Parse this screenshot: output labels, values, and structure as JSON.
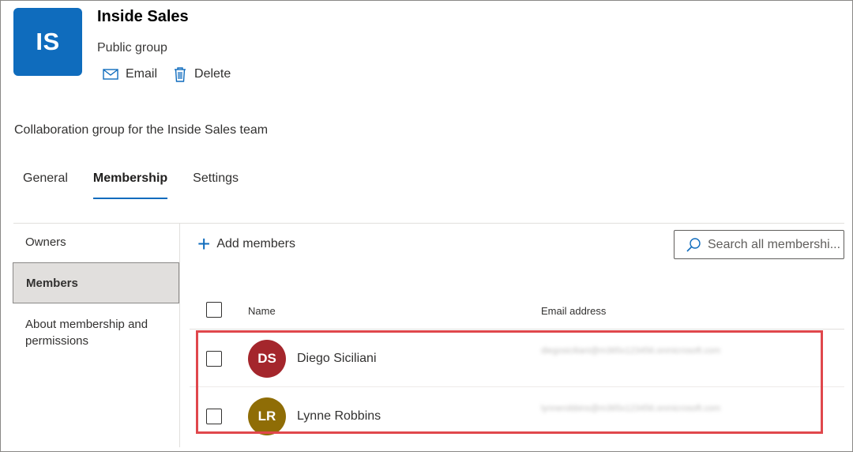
{
  "group": {
    "initials": "IS",
    "name": "Inside Sales",
    "type": "Public group",
    "description": "Collaboration group for the Inside Sales team",
    "tile_color": "#0f6cbd"
  },
  "actions": {
    "email_label": "Email",
    "email_icon": "mail-icon",
    "delete_label": "Delete",
    "delete_icon": "trash-icon"
  },
  "tabs": [
    {
      "label": "General",
      "active": false
    },
    {
      "label": "Membership",
      "active": true
    },
    {
      "label": "Settings",
      "active": false
    }
  ],
  "sidebar": {
    "items": [
      {
        "label": "Owners",
        "selected": false
      },
      {
        "label": "Members",
        "selected": true
      },
      {
        "label": "About membership and permissions",
        "selected": false
      }
    ]
  },
  "toolbar": {
    "add_members_label": "Add members",
    "add_icon": "plus-icon",
    "search_placeholder": "Search all membershi...",
    "search_icon": "search-icon"
  },
  "table": {
    "columns": {
      "name": "Name",
      "email": "Email address"
    },
    "rows": [
      {
        "initials": "DS",
        "name": "Diego Siciliani",
        "avatar_color": "#a4262c",
        "email": "diegosiciliani@m365x123456.onmicrosoft.com"
      },
      {
        "initials": "LR",
        "name": "Lynne Robbins",
        "avatar_color": "#8f6d06",
        "email": "lynnerobbins@m365x123456.onmicrosoft.com"
      }
    ]
  },
  "highlight_color": "#e0474c"
}
